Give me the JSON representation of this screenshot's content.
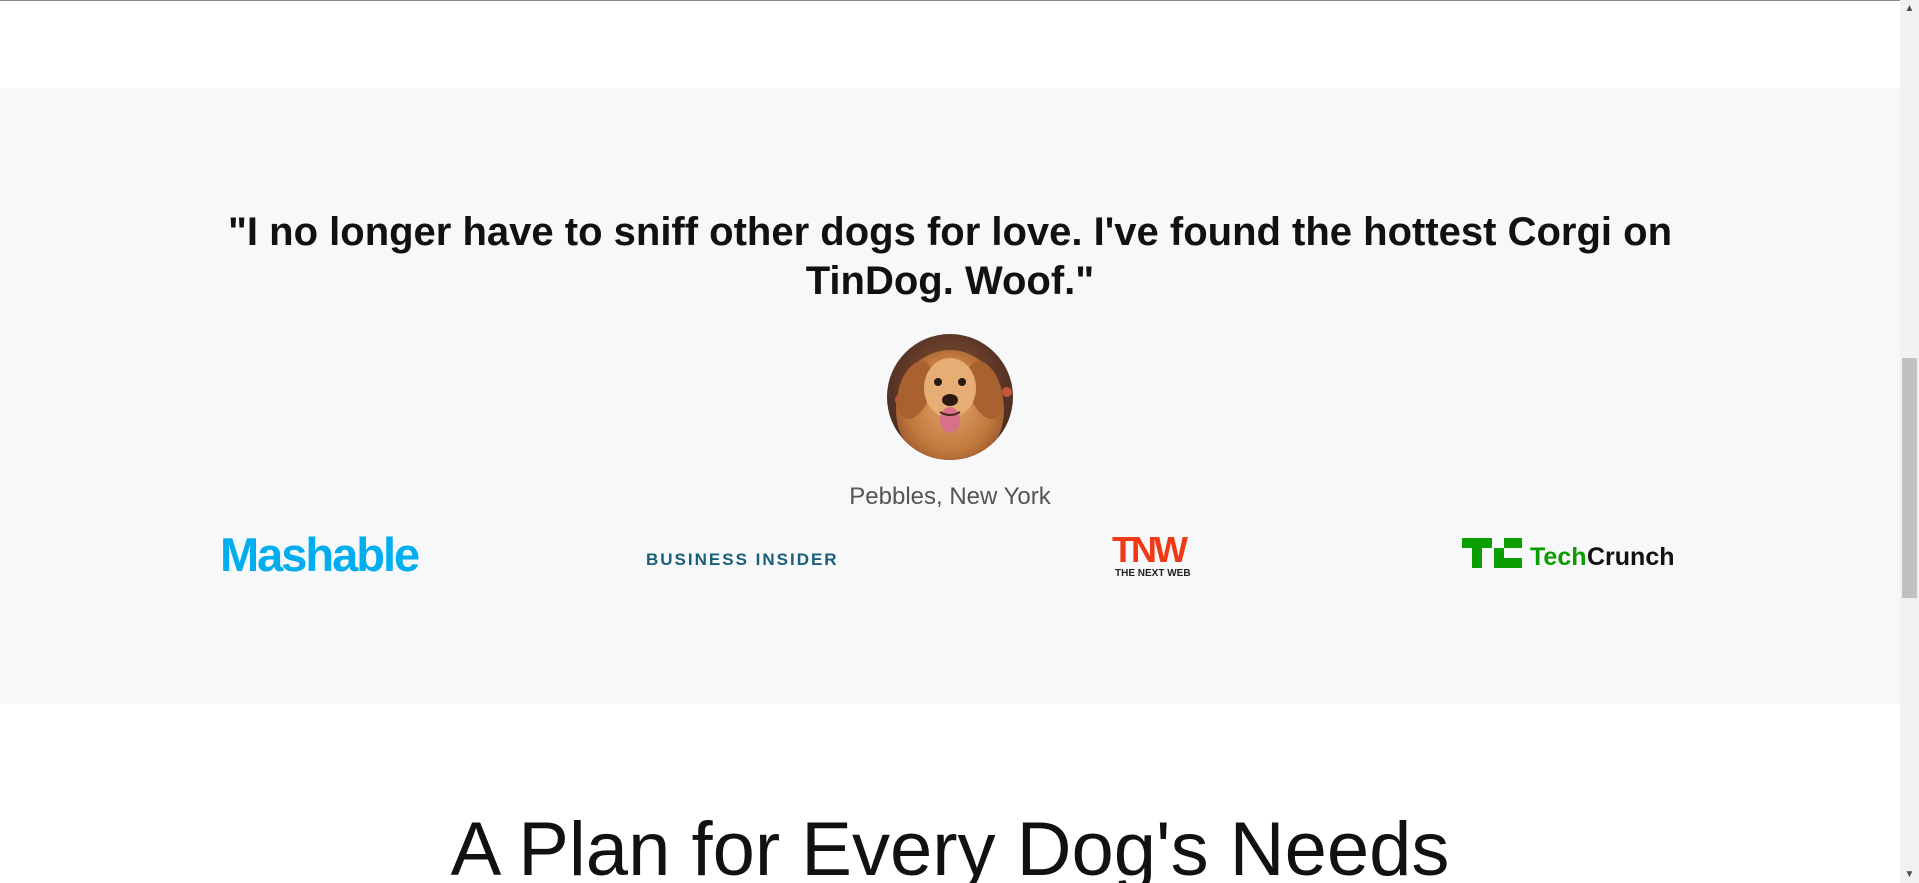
{
  "testimonial": {
    "quote": "\"I no longer have to sniff other dogs for love. I've found the hottest Corgi on TinDog. Woof.\"",
    "author": "Pebbles, New York"
  },
  "press": {
    "mashable": "Mashable",
    "business_insider": "BUSINESS INSIDER",
    "tnw_mark": "TNW",
    "tnw_sub": "THE NEXT WEB",
    "techcrunch_mark": "TC",
    "techcrunch_tech": "Tech",
    "techcrunch_crunch": "Crunch"
  },
  "pricing": {
    "title": "A Plan for Every Dog's Needs"
  },
  "colors": {
    "section_bg": "#f7f8f9",
    "mashable_blue": "#00aeef",
    "business_insider_teal": "#1a5e7a",
    "tnw_red": "#f03a17",
    "techcrunch_green": "#0a9e01"
  },
  "icons": {
    "avatar": "dog-photo",
    "scroll_up": "triangle-up-icon",
    "scroll_down": "triangle-down-icon"
  }
}
